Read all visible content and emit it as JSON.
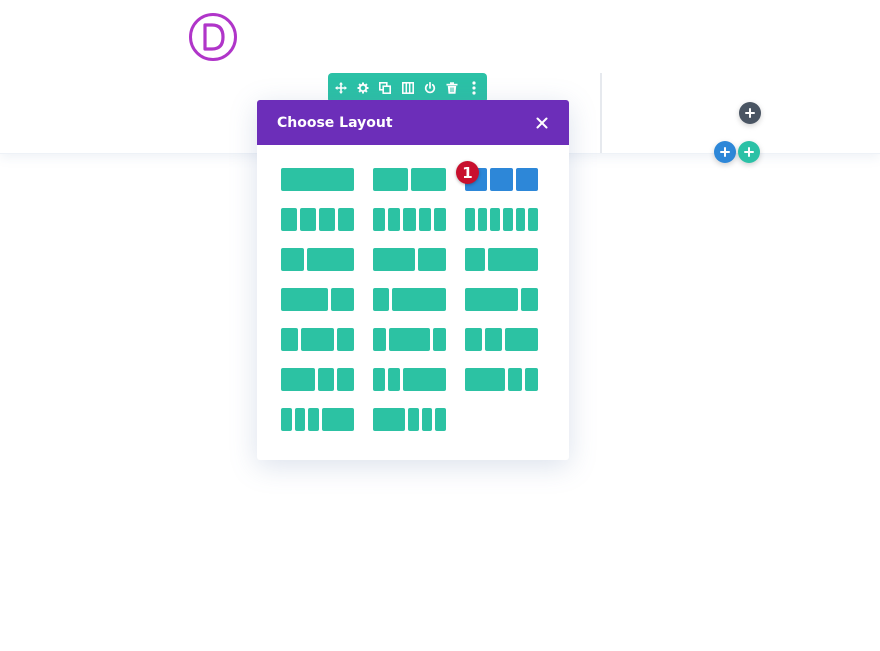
{
  "colors": {
    "accent_teal": "#2bc1a6",
    "modal_header_purple": "#6c2eb9",
    "selected_blue": "#2d87d8",
    "badge_red": "#c8102e",
    "dark_button": "#4a5563",
    "logo_magenta": "#b035c9"
  },
  "logo": {
    "letter": "D",
    "icon": "divi-logo-icon"
  },
  "row_toolbar": {
    "icons": [
      "move-icon",
      "gear-icon",
      "duplicate-icon",
      "columns-icon",
      "power-icon",
      "trash-icon",
      "more-icon"
    ]
  },
  "modal": {
    "title": "Choose Layout",
    "close_icon": "close-icon",
    "layouts": [
      {
        "ratios": [
          1
        ],
        "selected": false
      },
      {
        "ratios": [
          1,
          1
        ],
        "selected": false
      },
      {
        "ratios": [
          1,
          1,
          1
        ],
        "selected": true
      },
      {
        "ratios": [
          1,
          1,
          1,
          1
        ],
        "selected": false
      },
      {
        "ratios": [
          1,
          1,
          1,
          1,
          1
        ],
        "selected": false
      },
      {
        "ratios": [
          1,
          1,
          1,
          1,
          1,
          1
        ],
        "selected": false
      },
      {
        "ratios": [
          1,
          2
        ],
        "selected": false
      },
      {
        "ratios": [
          3,
          2
        ],
        "selected": false
      },
      {
        "ratios": [
          1,
          2.5
        ],
        "selected": false
      },
      {
        "ratios": [
          2,
          1
        ],
        "selected": false
      },
      {
        "ratios": [
          1,
          3.5
        ],
        "selected": false
      },
      {
        "ratios": [
          3,
          1
        ],
        "selected": false
      },
      {
        "ratios": [
          1,
          2,
          1
        ],
        "selected": false
      },
      {
        "ratios": [
          1,
          3,
          1
        ],
        "selected": false
      },
      {
        "ratios": [
          1,
          1,
          2
        ],
        "selected": false
      },
      {
        "ratios": [
          2,
          1,
          1
        ],
        "selected": false
      },
      {
        "ratios": [
          1,
          1,
          3.5
        ],
        "selected": false
      },
      {
        "ratios": [
          3,
          1,
          1
        ],
        "selected": false
      },
      {
        "ratios": [
          1,
          1,
          1,
          3
        ],
        "selected": false
      },
      {
        "ratios": [
          3,
          1,
          1,
          1
        ],
        "selected": false
      }
    ]
  },
  "badge": {
    "number": "1"
  },
  "buttons": {
    "add_row_icon": "plus-icon",
    "add_section_icon": "plus-icon",
    "add_module_icon": "plus-icon"
  }
}
